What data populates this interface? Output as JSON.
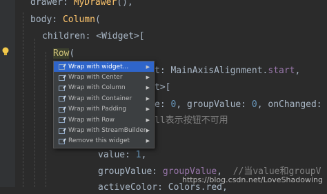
{
  "code": {
    "l1_prop": "drawer",
    "l1_cls": "MyDrawer",
    "l1_paren": "(),",
    "l2_prop": "body",
    "l2_cls": "Column",
    "l2_paren": "(",
    "l3": "children: <Widget>[",
    "l4_row": "Row",
    "l4_paren": "(",
    "l5_tail": "t: MainAxisAlignment.",
    "l5_val": "start",
    "l5_end": ",",
    "l6_tail": "t>[",
    "l7_a": "e: ",
    "l7_n1": "0",
    "l7_b": ", groupValue: ",
    "l7_n2": "0",
    "l7_c": ", onChanged:",
    "l8_comment": "ll表示按钮不可用",
    "l9_a": "value: ",
    "l9_n": "1",
    "l9_b": ",",
    "l10_a": "groupValue: ",
    "l10_p": "groupValue",
    "l10_b": ",  ",
    "l10_comment": "//当value和groupV",
    "l11": "activeColor: Colors.red,"
  },
  "menu": {
    "items": [
      {
        "label": "Wrap with widget...",
        "selected": true,
        "icon": "wrap-icon"
      },
      {
        "label": "Wrap with Center",
        "icon": "wrap-icon"
      },
      {
        "label": "Wrap with Column",
        "icon": "wrap-icon"
      },
      {
        "label": "Wrap with Container",
        "icon": "wrap-icon"
      },
      {
        "label": "Wrap with Padding",
        "icon": "wrap-icon"
      },
      {
        "label": "Wrap with Row",
        "icon": "wrap-icon"
      },
      {
        "label": "Wrap with StreamBuilder",
        "icon": "wrap-icon"
      },
      {
        "label": "Remove this widget",
        "icon": "wrap-icon"
      }
    ],
    "submenu_arrow": "▶"
  },
  "watermark": "https://blog.csdn.net/LoveShadowing",
  "colors": {
    "background": "#2b2b2b",
    "menu": "#3c3f41",
    "selected": "#2f65ca"
  }
}
